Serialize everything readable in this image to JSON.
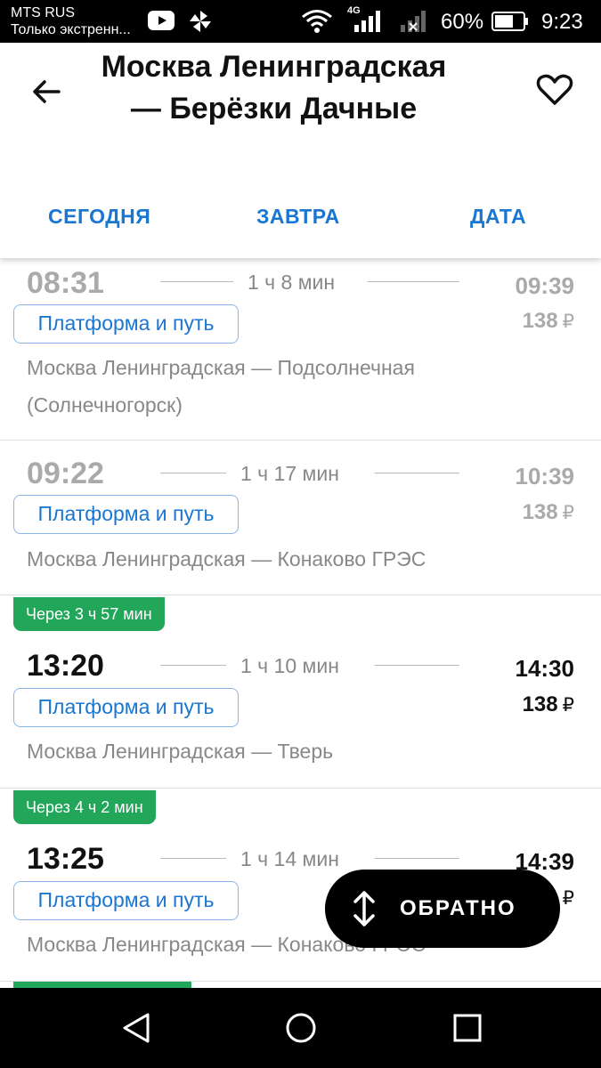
{
  "status_bar": {
    "carrier": "MTS RUS",
    "subtext": "Только экстренн...",
    "network": "4G",
    "battery": "60%",
    "time": "9:23"
  },
  "header": {
    "title": "Москва Ленинградская — Берёзки Дачные",
    "tabs": [
      "СЕГОДНЯ",
      "ЗАВТРА",
      "ДАТА"
    ]
  },
  "trains": [
    {
      "departure": "08:31",
      "duration": "1 ч  8 мин",
      "arrival": "09:39",
      "price": "138",
      "currency": "₽",
      "platform_label": "Платформа и путь",
      "route": "Москва Ленинградская — Подсолнечная (Солнечногорск)",
      "badge": "",
      "past": true
    },
    {
      "departure": "09:22",
      "duration": "1 ч  17 мин",
      "arrival": "10:39",
      "price": "138",
      "currency": "₽",
      "platform_label": "Платформа и путь",
      "route": "Москва Ленинградская — Конаково ГРЭС",
      "badge": "",
      "past": true
    },
    {
      "departure": "13:20",
      "duration": "1 ч  10 мин",
      "arrival": "14:30",
      "price": "138",
      "currency": "₽",
      "platform_label": "Платформа и путь",
      "route": "Москва Ленинградская — Тверь",
      "badge": "Через 3 ч 57 мин",
      "past": false
    },
    {
      "departure": "13:25",
      "duration": "1 ч  14 мин",
      "arrival": "14:39",
      "price": "",
      "currency": "₽",
      "platform_label": "Платформа и путь",
      "route": "Москва Ленинградская — Конаково ГРЭС",
      "badge": "Через 4 ч 2 мин",
      "past": false
    }
  ],
  "fab": {
    "label": "ОБРАТНО",
    "icon": "swap-vertical-icon"
  },
  "colors": {
    "accent": "#1976d2",
    "badge": "#21a65a",
    "past_text": "#aaaaaa"
  }
}
